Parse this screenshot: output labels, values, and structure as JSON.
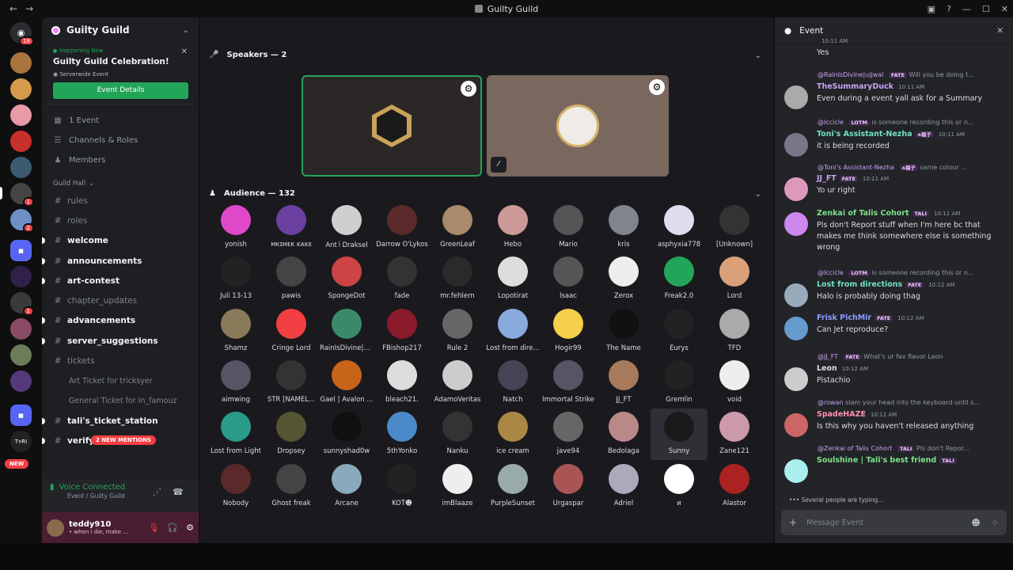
{
  "window": {
    "title": "Guilty Guild",
    "back": "←",
    "forward": "→"
  },
  "rail": {
    "badge_top": "18",
    "new_label": "NEW",
    "badges": [
      "1",
      "2",
      "1"
    ]
  },
  "sidebar": {
    "guild_name": "Guilty Guild",
    "event": {
      "status": "Happening Now",
      "title": "Guilty Guild Celebration!",
      "location": "Serverwide Event",
      "button": "Event Details"
    },
    "items": [
      {
        "icon": "calendar-icon",
        "label": "1 Event"
      },
      {
        "icon": "channels-roles-icon",
        "label": "Channels & Roles"
      },
      {
        "icon": "members-icon",
        "label": "Members"
      }
    ],
    "category": "Guild Hall",
    "channels": [
      {
        "label": "rules",
        "unread": false
      },
      {
        "label": "roles",
        "unread": false
      },
      {
        "label": "welcome",
        "unread": true
      },
      {
        "label": "announcements",
        "unread": true
      },
      {
        "label": "art-contest",
        "unread": true
      },
      {
        "label": "chapter_updates",
        "unread": false
      },
      {
        "label": "advancements",
        "unread": true
      },
      {
        "label": "server_suggestions",
        "unread": true
      },
      {
        "label": "tickets",
        "unread": false
      }
    ],
    "threads": [
      "Art Ticket for tricksyer",
      "General Ticket for In_famouz"
    ],
    "channels2": [
      {
        "label": "tali's_ticket_station",
        "unread": true
      },
      {
        "label": "verify",
        "unread": true
      }
    ],
    "mentions_pill": "2 NEW MENTIONS"
  },
  "voice": {
    "status": "Voice Connected",
    "channel": "Event / Guilty Guild"
  },
  "user": {
    "name": "teddy910",
    "status": "• when i die, make ..."
  },
  "stage": {
    "speakers_header": "Speakers — 2",
    "audience_header": "Audience — 132",
    "audience": [
      "yonish",
      "ᴍᴋɪᴍᴇᴋ ᴋᴀᴋᴇ",
      "Ant꒰Draksel",
      "Darrow O'Lykos",
      "GreenLeaf",
      "Hebo",
      "Mario",
      "kris",
      "asphyxia778",
      "[Unknown]",
      "Juli 13-13",
      "pawis",
      "SpongeDot",
      "fade",
      "mr.fehlern",
      "Lopotirat",
      "Isaac",
      "Zerox",
      "Freak2.0",
      "Lord",
      "Shamz",
      "Cringe Lord",
      "RainIsDivine|u...",
      "FBishop217",
      "Rule 2",
      "Lost from dire...",
      "Hogir99",
      "The Name",
      "Eurys",
      "TFD",
      "aimwing",
      "STR [NAMEL...",
      "Gael | Avalon ...",
      "bleach21.",
      "AdamoVeritas",
      "Natch",
      "Immortal Strike",
      "JJ_FT",
      "Gremlin",
      "void",
      "Lost from Light",
      "Dropsey",
      "sunnyshad0w",
      "5thYonko",
      "Nanku",
      "ice cream",
      "jave94",
      "Bedolaga",
      "Sunny",
      "Zane121",
      "Nobody",
      "Ghost freak",
      "Arcane",
      "KOT☻",
      "imBlaaze",
      "PurpleSunset",
      "Urgaspar",
      "Adriel",
      "и",
      "Alastor"
    ]
  },
  "panel": {
    "title": "Event",
    "messages": [
      {
        "time": "10:11 AM",
        "text": "Yes"
      },
      {
        "reply_author": "@RainIsDivine|ujjwal",
        "reply_tag": "FATE",
        "reply_text": "Will you be doing t...",
        "name": "TheSummaryDuck",
        "name_color": "#c8a2f5",
        "time": "10:11 AM",
        "text": "Even during a event yall ask for a Summary"
      },
      {
        "reply_author": "@Icciclе",
        "reply_tag": "LOTM",
        "reply_text": "is someone recording this or n...",
        "name": "Toni's Assistant-Nezha",
        "name_color": "#6fe3c8",
        "tag": "ᴀ福子",
        "time": "10:11 AM",
        "text": "it is being recorded"
      },
      {
        "reply_author": "@Toni's Assistant-Nezha",
        "reply_tag": "ᴀ福子",
        "reply_text": "same colour ...",
        "name": "JJ_FT",
        "name_color": "#c8a2f5",
        "tag": "FATE",
        "time": "10:11 AM",
        "text": "Yo ur right"
      },
      {
        "name": "Zenkai of Talis Cohort",
        "name_color": "#7ee08a",
        "tag": "TALI",
        "time": "10:11 AM",
        "text": "Pls don't Report stuff when I'm here bc that makes me think somewhere else is something wrong"
      },
      {
        "reply_author": "@Icciclе",
        "reply_tag": "LOTM",
        "reply_text": "is someone recording this or n...",
        "name": "Lost from directions",
        "name_color": "#6fe3c8",
        "tag": "FATE",
        "time": "10:12 AM",
        "text": "Halo is probably doing thag"
      },
      {
        "name": "Frisk PichMir",
        "name_color": "#8c9cff",
        "tag": "FATE",
        "time": "10:12 AM",
        "text": "Can Jet reproduce?"
      },
      {
        "reply_author": "@JJ_FT",
        "reply_tag": "FATE",
        "reply_text": "What's ur fav flavor Leon",
        "name": "Leon",
        "name_color": "#dbdee1",
        "time": "10:12 AM",
        "text": "Pistachio"
      },
      {
        "reply_author": "@rowan",
        "reply_tag": "",
        "reply_text": "slam your head into the keyboard until s...",
        "name": "SpadeHAZE",
        "name_color": "#ff8fb1",
        "time": "10:12 AM",
        "text": "Is this why you haven't released anything"
      },
      {
        "reply_author": "@Zenkai of Talis Cohort",
        "reply_tag": "TALI",
        "reply_text": "Pls don't Repor...",
        "name": "Soulshine | Tali's best friend",
        "name_color": "#7ee08a",
        "tag": "TALI",
        "time": "",
        "text": ""
      }
    ],
    "typing": "Several people are typing...",
    "composer_placeholder": "Message Event"
  },
  "colors": {
    "accent_green": "#23a559",
    "danger": "#f23f43",
    "blurple": "#5865f2",
    "user_panel": "#4a1d33"
  }
}
